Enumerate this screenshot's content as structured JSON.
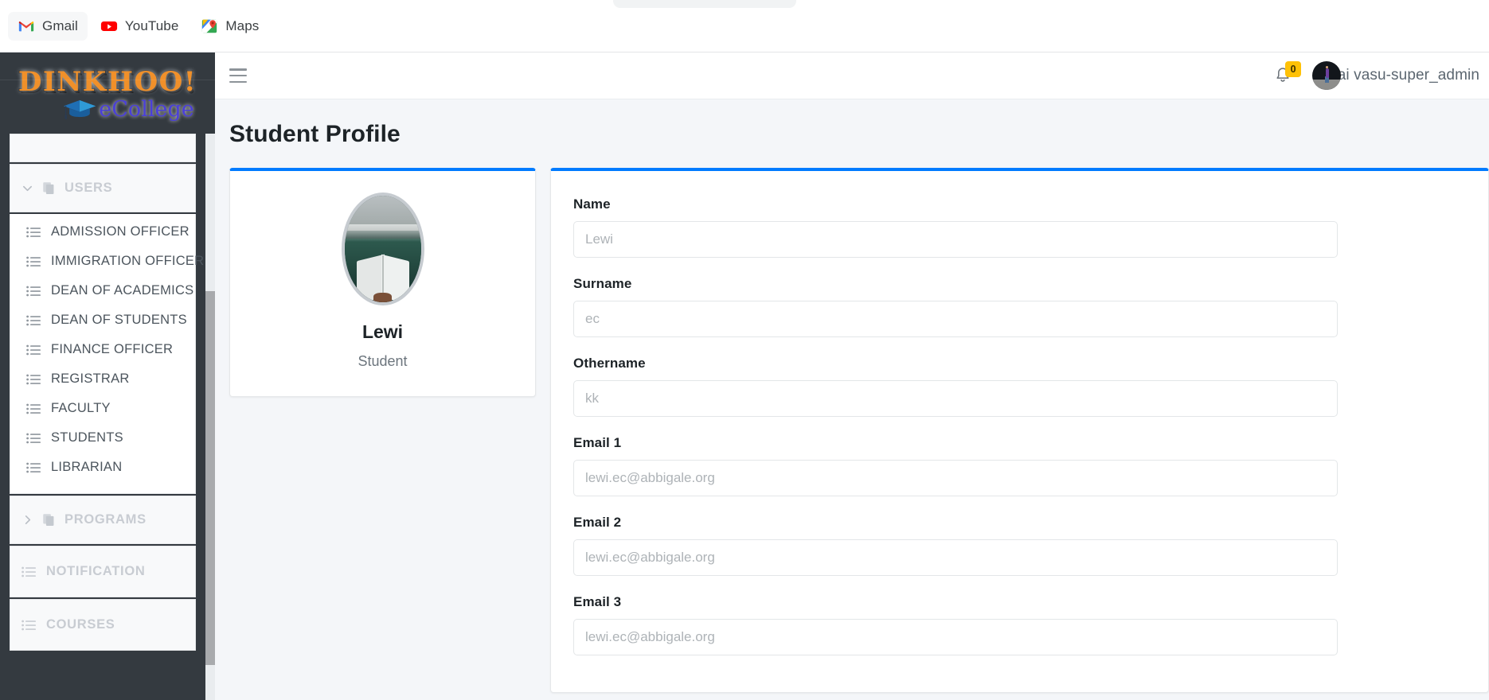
{
  "browser": {
    "bookmarks": [
      {
        "label": "Gmail",
        "icon": "gmail-icon",
        "active": true
      },
      {
        "label": "YouTube",
        "icon": "youtube-icon",
        "active": false
      },
      {
        "label": "Maps",
        "icon": "google-maps-icon",
        "active": false
      }
    ]
  },
  "sidebar": {
    "brand": {
      "word": "DINKHOO!",
      "suffix": "eCollege"
    },
    "groups": [
      {
        "label": "USERS",
        "expanded": true,
        "icon": "copy-icon",
        "chevron": "chevron-down-icon",
        "items": [
          {
            "label": "ADMISSION OFFICER",
            "icon": "list-icon"
          },
          {
            "label": "IMMIGRATION OFFICER",
            "icon": "list-icon"
          },
          {
            "label": "DEAN OF ACADEMICS",
            "icon": "list-icon"
          },
          {
            "label": "DEAN OF STUDENTS",
            "icon": "list-icon"
          },
          {
            "label": "FINANCE OFFICER",
            "icon": "list-icon"
          },
          {
            "label": "REGISTRAR",
            "icon": "list-icon"
          },
          {
            "label": "FACULTY",
            "icon": "list-icon"
          },
          {
            "label": "STUDENTS",
            "icon": "list-icon"
          },
          {
            "label": "LIBRARIAN",
            "icon": "list-icon"
          }
        ]
      },
      {
        "label": "PROGRAMS",
        "expanded": false,
        "icon": "copy-icon",
        "chevron": "chevron-right-icon",
        "items": []
      }
    ],
    "singles": [
      {
        "label": "NOTIFICATION",
        "icon": "list-icon"
      },
      {
        "label": "COURSES",
        "icon": "list-icon"
      }
    ]
  },
  "topbar": {
    "menu_toggle": "hamburger-icon",
    "notifications": {
      "icon": "bell-icon",
      "count": "0",
      "badge_color": "#ffc107"
    },
    "user": {
      "name": "sai vasu-super_admin",
      "avatar": "user-avatar"
    }
  },
  "page": {
    "title": "Student Profile",
    "accent_color": "#007bff"
  },
  "profile_card": {
    "name": "Lewi",
    "role": "Student",
    "avatar": "student-photo"
  },
  "form": {
    "fields": [
      {
        "label": "Name",
        "value": "",
        "placeholder": "Lewi"
      },
      {
        "label": "Surname",
        "value": "",
        "placeholder": "ec"
      },
      {
        "label": "Othername",
        "value": "",
        "placeholder": "kk"
      },
      {
        "label": "Email 1",
        "value": "",
        "placeholder": "lewi.ec@abbigale.org"
      },
      {
        "label": "Email 2",
        "value": "",
        "placeholder": "lewi.ec@abbigale.org"
      },
      {
        "label": "Email 3",
        "value": "",
        "placeholder": "lewi.ec@abbigale.org"
      }
    ]
  }
}
